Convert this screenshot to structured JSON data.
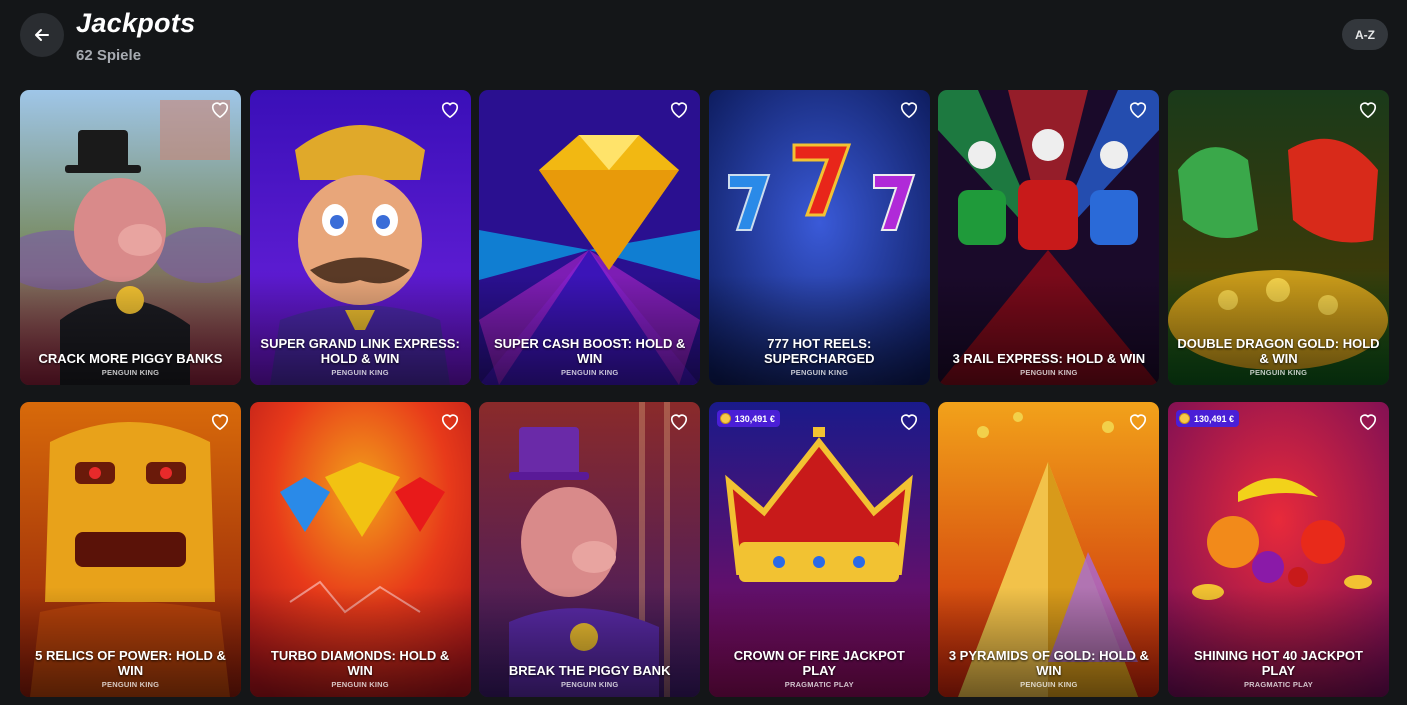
{
  "header": {
    "title": "Jackpots",
    "subtitle": "62 Spiele",
    "sort_label": "A-Z"
  },
  "icons": {
    "back": "arrow-left-icon",
    "favorite": "heart-outline-icon"
  },
  "colors": {
    "background": "#141618",
    "badge": "#4a1fd6"
  },
  "games": [
    {
      "title": "CRACK MORE PIGGY BANKS",
      "provider": "PENGUIN KING",
      "jackpot": null
    },
    {
      "title": "SUPER GRAND LINK EXPRESS: HOLD & WIN",
      "provider": "PENGUIN KING",
      "jackpot": null
    },
    {
      "title": "SUPER CASH BOOST: HOLD & WIN",
      "provider": "PENGUIN KING",
      "jackpot": null
    },
    {
      "title": "777 HOT REELS: SUPERCHARGED",
      "provider": "PENGUIN KING",
      "jackpot": null
    },
    {
      "title": "3 RAIL EXPRESS: HOLD & WIN",
      "provider": "PENGUIN KING",
      "jackpot": null
    },
    {
      "title": "DOUBLE DRAGON GOLD: HOLD & WIN",
      "provider": "PENGUIN KING",
      "jackpot": null
    },
    {
      "title": "5 RELICS OF POWER: HOLD & WIN",
      "provider": "PENGUIN KING",
      "jackpot": null
    },
    {
      "title": "TURBO DIAMONDS: HOLD & WIN",
      "provider": "PENGUIN KING",
      "jackpot": null
    },
    {
      "title": "BREAK THE PIGGY BANK",
      "provider": "PENGUIN KING",
      "jackpot": null
    },
    {
      "title": "CROWN OF FIRE JACKPOT PLAY",
      "provider": "PRAGMATIC PLAY",
      "jackpot": "130,491 €"
    },
    {
      "title": "3 PYRAMIDS OF GOLD: HOLD & WIN",
      "provider": "PENGUIN KING",
      "jackpot": null
    },
    {
      "title": "SHINING HOT 40 JACKPOT PLAY",
      "provider": "PRAGMATIC PLAY",
      "jackpot": "130,491 €"
    }
  ]
}
